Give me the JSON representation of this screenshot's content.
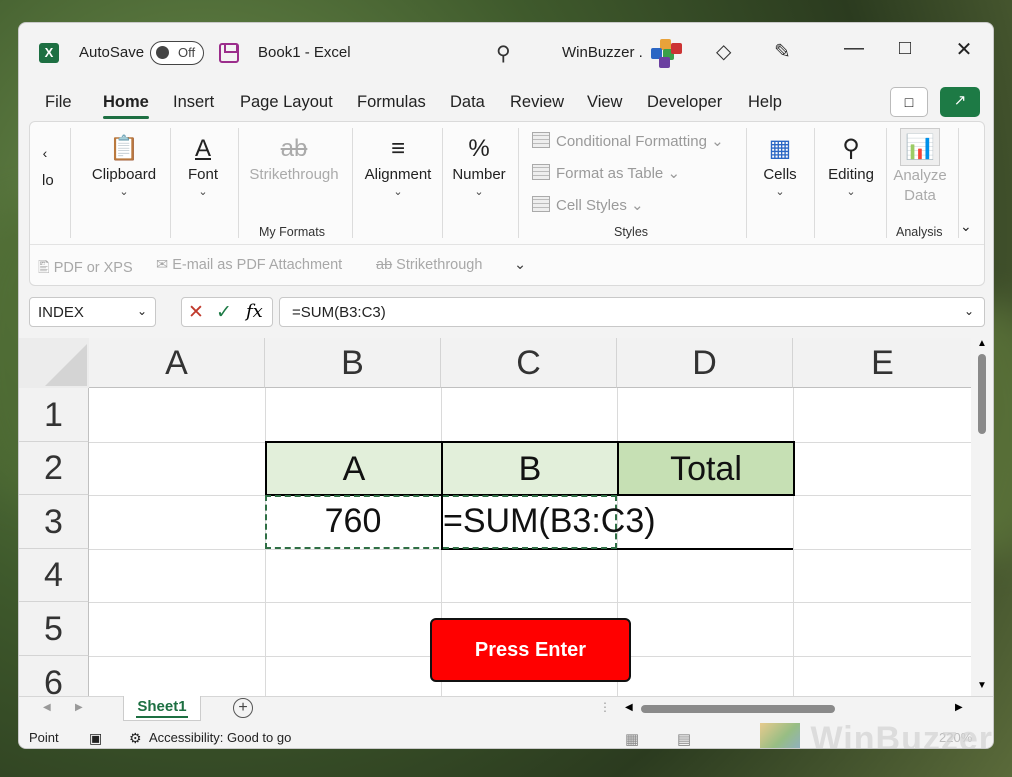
{
  "titlebar": {
    "autosave_label": "AutoSave",
    "autosave_state": "Off",
    "doc_title": "Book1  -  Excel",
    "user_name": "WinBuzzer ."
  },
  "menu": [
    "File",
    "Home",
    "Insert",
    "Page Layout",
    "Formulas",
    "Data",
    "Review",
    "View",
    "Developer",
    "Help"
  ],
  "ribbon": {
    "clipboard": "Clipboard",
    "font": "Font",
    "strikethrough": "Strikethrough",
    "my_formats_label": "My Formats",
    "alignment": "Alignment",
    "number": "Number",
    "conditional_formatting": "Conditional Formatting",
    "format_as_table": "Format as Table",
    "cell_styles": "Cell Styles",
    "styles_label": "Styles",
    "cells": "Cells",
    "editing": "Editing",
    "analyze_data_line1": "Analyze",
    "analyze_data_line2": "Data",
    "analysis_label": "Analysis",
    "undo_fragment": "lo"
  },
  "qat": {
    "pdf_xps": "PDF or XPS",
    "email_pdf": "E-mail as PDF Attachment",
    "strikethrough": "Strikethrough"
  },
  "formula_bar": {
    "name_box": "INDEX",
    "formula": "=SUM(B3:C3)"
  },
  "grid": {
    "columns": [
      "A",
      "B",
      "C",
      "D",
      "E"
    ],
    "rows": [
      "1",
      "2",
      "3",
      "4",
      "5",
      "6"
    ],
    "b2": "A",
    "c2": "B",
    "d2": "Total",
    "b3": "760",
    "c3": "=SUM(B3:C3)"
  },
  "callout": "Press Enter",
  "sheet_tab": "Sheet1",
  "status": {
    "mode": "Point",
    "accessibility": "Accessibility: Good to go",
    "zoom": "220%"
  },
  "watermark": "WinBuzzer",
  "colors": {
    "excel_green": "#1d6f42",
    "header_fill": "#e2efda",
    "total_fill": "#c6e0b4",
    "callout_red": "#ff0000"
  }
}
